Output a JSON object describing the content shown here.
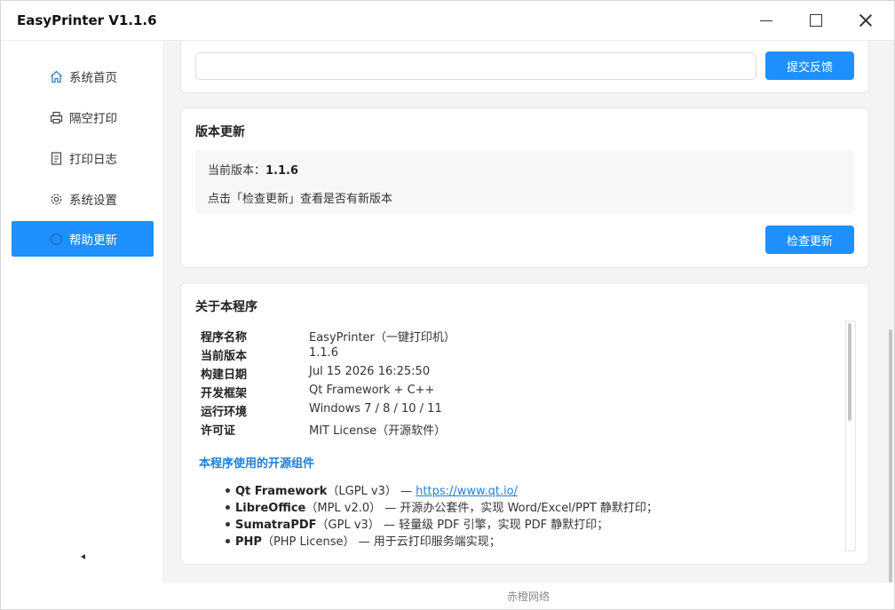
{
  "window": {
    "title": "EasyPrinter  V1.1.6"
  },
  "sidebar": {
    "items": [
      {
        "label": "系统首页",
        "icon": "home-icon"
      },
      {
        "label": "隔空打印",
        "icon": "print-icon"
      },
      {
        "label": "打印日志",
        "icon": "document-icon"
      },
      {
        "label": "系统设置",
        "icon": "gear-icon"
      },
      {
        "label": "帮助更新",
        "icon": "help-icon",
        "active": true
      }
    ],
    "accent": "#1e90ff"
  },
  "feedback": {
    "submit_label": "提交反馈",
    "input_value": ""
  },
  "update": {
    "title": "版本更新",
    "current_label": "当前版本：",
    "current_version": "1.1.6",
    "hint": "点击「检查更新」查看是否有新版本",
    "check_label": "检查更新"
  },
  "about": {
    "title": "关于本程序",
    "rows": [
      {
        "key": "程序名称",
        "value": "EasyPrinter（一键打印机）"
      },
      {
        "key": "当前版本",
        "value": "1.1.6"
      },
      {
        "key": "构建日期",
        "value": "Jul 15 2026 16:25:50"
      },
      {
        "key": "开发框架",
        "value": "Qt Framework + C++"
      },
      {
        "key": "运行环境",
        "value": "Windows 7 / 8 / 10 / 11"
      },
      {
        "key": "许可证",
        "value": "MIT License（开源软件）"
      }
    ],
    "oss_title": "本程序使用的开源组件",
    "oss": [
      {
        "name": "Qt Framework",
        "license": "（LGPL v3）",
        "desc": " — ",
        "link": "https://www.qt.io/"
      },
      {
        "name": "LibreOffice",
        "license": "（MPL v2.0）",
        "desc": " — 开源办公套件，实现 Word/Excel/PPT 静默打印；",
        "link": ""
      },
      {
        "name": "SumatraPDF",
        "license": "（GPL v3）",
        "desc": " — 轻量级 PDF 引擎，实现 PDF 静默打印；",
        "link": ""
      },
      {
        "name": "PHP",
        "license": "（PHP License）",
        "desc": " — 用于云打印服务端实现；",
        "link": ""
      }
    ]
  },
  "footer": {
    "text": "赤橙网络"
  }
}
